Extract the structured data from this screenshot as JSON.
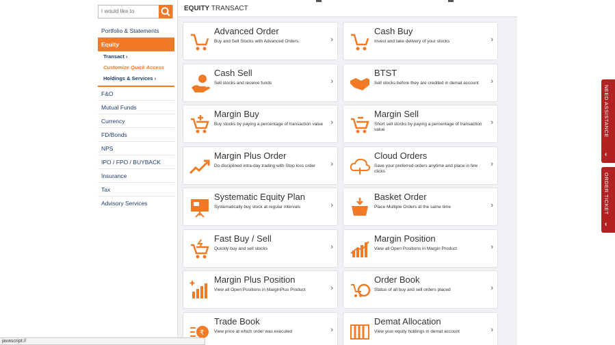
{
  "search": {
    "placeholder": "I would like to"
  },
  "nav": {
    "items_top": [
      "Portfolio & Statements"
    ],
    "active": "Equity",
    "sub": [
      "Transact  ›",
      "Customize Quick Access",
      "Holdings & Services  ›"
    ],
    "items": [
      "F&O",
      "Mutual Funds",
      "Currency",
      "FD/Bonds",
      "NPS",
      "IPO / FPO / BUYBACK",
      "Insurance",
      "Tax",
      "Advisory Services"
    ]
  },
  "header": {
    "title_bold": "EQUITY",
    "title_rest": " TRANSACT"
  },
  "cards": [
    {
      "title": "Advanced Order",
      "desc": "Buy and Sell Stocks with Advanced Orders.",
      "icon": "cart-icon"
    },
    {
      "title": "Cash Buy",
      "desc": "Invest and take delivery of your stocks",
      "icon": "cart-icon"
    },
    {
      "title": "Cash Sell",
      "desc": "Sell stocks and receive funds",
      "icon": "hand-coin-icon"
    },
    {
      "title": "BTST",
      "desc": "Sell stocks before they are credited in demat account",
      "icon": "handshake-icon"
    },
    {
      "title": "Margin Buy",
      "desc": "Buy stocks by paying a percentage of transaction value",
      "icon": "cart-plus-icon"
    },
    {
      "title": "Margin Sell",
      "desc": "Short sell stocks by paying a percentage of transaction value",
      "icon": "cart-minus-icon"
    },
    {
      "title": "Margin Plus Order",
      "desc": "Do disciplined intra-day trading with Stop loss order",
      "icon": "trend-up-icon"
    },
    {
      "title": "Cloud Orders",
      "desc": "Save your preferred orders anytime and place in few clicks",
      "icon": "cloud-icon"
    },
    {
      "title": "Systematic Equity Plan",
      "desc": "Systematically buy stock at regular intervals",
      "icon": "presentation-icon"
    },
    {
      "title": "Basket Order",
      "desc": "Place Multiple Orders at the same time",
      "icon": "basket-icon"
    },
    {
      "title": "Fast Buy / Sell",
      "desc": "Quickly buy and sell stocks",
      "icon": "fast-cart-icon"
    },
    {
      "title": "Margin Position",
      "desc": "View all Open Positions in Margin Product",
      "icon": "bar-chart-icon"
    },
    {
      "title": "Margin Plus Position",
      "desc": "View all Open Positions in MarginPlus Product",
      "icon": "bar-chart-plus-icon"
    },
    {
      "title": "Order Book",
      "desc": "Status of all buy and sell orders placed",
      "icon": "order-book-icon"
    },
    {
      "title": "Trade Book",
      "desc": "View price at which order was executed",
      "icon": "trade-book-icon"
    },
    {
      "title": "Demat Allocation",
      "desc": "View your equity holdings in demat account",
      "icon": "demat-icon"
    }
  ],
  "right_tabs": {
    "assist": "NEED ASSISTANCE",
    "ticket": "ORDER TICKET"
  },
  "status_bar": "javascript://",
  "colors": {
    "accent": "#f27a24",
    "nav_text": "#1c3b6e",
    "tab_red": "#b22222"
  }
}
